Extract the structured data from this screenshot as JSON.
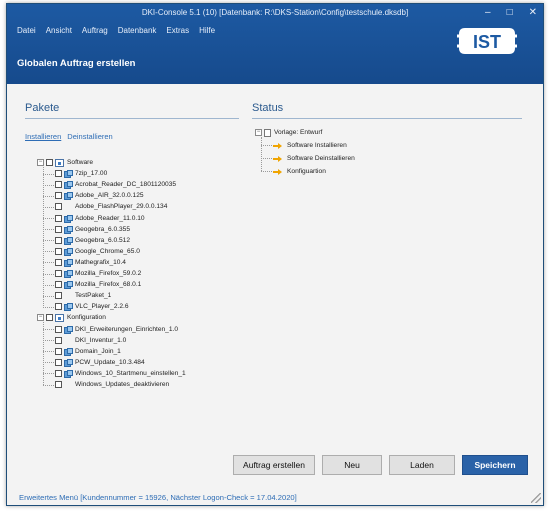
{
  "window": {
    "title": "DKI-Console 5.1 (10) [Datenbank: R:\\DKS-Station\\Config\\testschule.dksdb]",
    "controls": [
      "–",
      "□",
      "✕"
    ]
  },
  "menu": [
    "Datei",
    "Ansicht",
    "Auftrag",
    "Datenbank",
    "Extras",
    "Hilfe"
  ],
  "page_title": "Globalen Auftrag erstellen",
  "logo_text": "IST",
  "pakete": {
    "title": "Pakete",
    "link_install": "Installieren",
    "link_uninstall": "Deinstallieren",
    "software_label": "Software",
    "software_items": [
      "7zip_17.00",
      "Acrobat_Reader_DC_1801120035",
      "Adobe_AIR_32.0.0.125",
      "Adobe_FlashPlayer_29.0.0.134",
      "Adobe_Reader_11.0.10",
      "Geogebra_6.0.355",
      "Geogebra_6.0.512",
      "Google_Chrome_65.0",
      "Mathegrafix_10.4",
      "Mozilla_Firefox_59.0.2",
      "Mozilla_Firefox_68.0.1",
      "TestPaket_1",
      "VLC_Player_2.2.6"
    ],
    "config_label": "Konfiguration",
    "config_items": [
      "DKI_Erweiterungen_Einrichten_1.0",
      "DKI_Inventur_1.0",
      "Domain_Join_1",
      "PCW_Update_10.3.484",
      "Windows_10_Startmenu_einstellen_1",
      "Windows_Updates_deaktivieren"
    ],
    "icon_flags": [
      true,
      true,
      true,
      false,
      true,
      true,
      true,
      true,
      true,
      true,
      true,
      false,
      true
    ],
    "config_icon_flags": [
      true,
      false,
      true,
      true,
      true,
      false
    ]
  },
  "status": {
    "title": "Status",
    "root_label": "Vorlage: Entwurf",
    "items": [
      "Software Installieren",
      "Software Deinstallieren",
      "Konfiguartion"
    ]
  },
  "buttons": {
    "create": "Auftrag erstellen",
    "new": "Neu",
    "load": "Laden",
    "save": "Speichern"
  },
  "footer": "Erweitertes Menü [Kundennummer = 15926, Nächster Logon-Check = 17.04.2020]",
  "colors": {
    "header": "#1d5aa3",
    "accent": "#2a62a8",
    "link": "#2e6db5",
    "status_arrow": "#f0a400"
  }
}
